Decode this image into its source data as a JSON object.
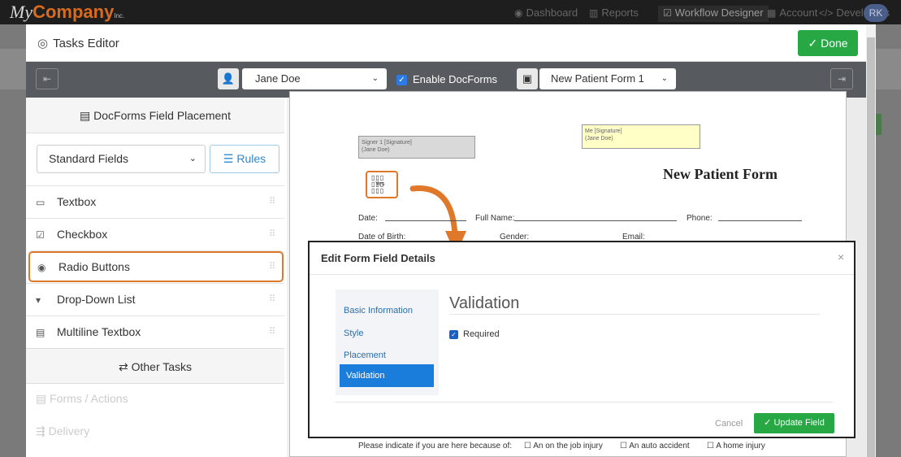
{
  "topnav": {
    "logo_my": "My",
    "logo_company": "Company",
    "logo_inc": "Inc.",
    "items": [
      {
        "label": "Dashboard",
        "icon": "dashboard-icon"
      },
      {
        "label": "Reports",
        "icon": "chart-icon"
      },
      {
        "label": "Workflow Designer",
        "icon": "workflow-icon"
      },
      {
        "label": "Account",
        "icon": "building-icon"
      },
      {
        "label": "Developers",
        "icon": "code-icon"
      }
    ],
    "avatar": "RK"
  },
  "modal": {
    "title": "Tasks Editor",
    "done_label": "Done"
  },
  "toolbar": {
    "user": "Jane Doe",
    "enable_label": "Enable DocForms",
    "form": "New Patient Form 1"
  },
  "sidebar": {
    "section_title": "DocForms Field Placement",
    "field_set": "Standard Fields",
    "rules_label": "Rules",
    "fields": [
      {
        "label": "Textbox",
        "icon": "textbox-icon"
      },
      {
        "label": "Checkbox",
        "icon": "checkbox-icon"
      },
      {
        "label": "Radio Buttons",
        "icon": "radio-icon"
      },
      {
        "label": "Drop-Down List",
        "icon": "dropdown-icon"
      },
      {
        "label": "Multiline Textbox",
        "icon": "multiline-icon"
      }
    ],
    "other_tasks": "Other Tasks",
    "other_items": [
      "Forms / Actions",
      "Delivery"
    ]
  },
  "document": {
    "signer1_line1": "Signer 1 [Signature]",
    "signer1_line2": "(Jane Doe)",
    "me_line1": "Me [Signature]",
    "me_line2": "(Jane Doe)",
    "title": "New Patient Form",
    "date": "Date:",
    "full_name": "Full Name:",
    "phone": "Phone:",
    "dob": "Date of Birth:",
    "gender": "Gender:",
    "email": "Email:",
    "bottom_prompt": "Please indicate if you are here because of:",
    "opt1": "An on the job injury",
    "opt2": "An auto accident",
    "opt3": "A home injury",
    "radio_label": "Yes"
  },
  "dialog": {
    "title": "Edit Form Field Details",
    "nav": [
      "Basic Information",
      "Style",
      "Placement",
      "Validation"
    ],
    "heading": "Validation",
    "required_label": "Required",
    "cancel": "Cancel",
    "update": "Update Field"
  }
}
